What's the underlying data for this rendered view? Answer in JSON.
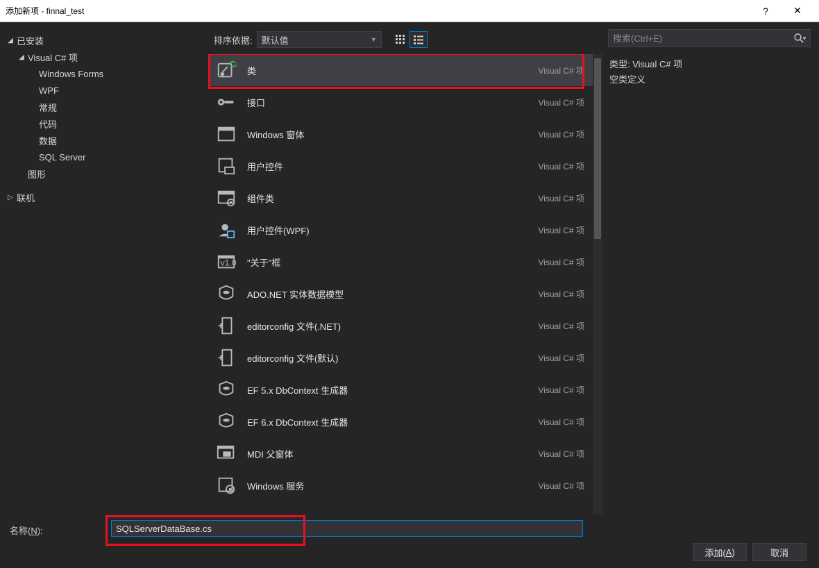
{
  "window": {
    "title": "添加新项 - finnal_test"
  },
  "sidebar": {
    "installed": "已安装",
    "vcs": "Visual C# 项",
    "children": [
      "Windows Forms",
      "WPF",
      "常规",
      "代码",
      "数据",
      "SQL Server"
    ],
    "graphics": "图形",
    "online": "联机"
  },
  "sort": {
    "label": "排序依据:",
    "value": "默认值"
  },
  "templates": [
    {
      "name": "类",
      "lang": "Visual C# 项"
    },
    {
      "name": "接口",
      "lang": "Visual C# 项"
    },
    {
      "name": "Windows 窗体",
      "lang": "Visual C# 项"
    },
    {
      "name": "用户控件",
      "lang": "Visual C# 项"
    },
    {
      "name": "组件类",
      "lang": "Visual C# 项"
    },
    {
      "name": "用户控件(WPF)",
      "lang": "Visual C# 项"
    },
    {
      "name": "\"关于\"框",
      "lang": "Visual C# 项"
    },
    {
      "name": "ADO.NET 实体数据模型",
      "lang": "Visual C# 项"
    },
    {
      "name": "editorconfig 文件(.NET)",
      "lang": "Visual C# 项"
    },
    {
      "name": "editorconfig 文件(默认)",
      "lang": "Visual C# 项"
    },
    {
      "name": "EF 5.x DbContext 生成器",
      "lang": "Visual C# 项"
    },
    {
      "name": "EF 6.x DbContext 生成器",
      "lang": "Visual C# 项"
    },
    {
      "name": "MDI 父窗体",
      "lang": "Visual C# 项"
    },
    {
      "name": "Windows 服务",
      "lang": "Visual C# 项"
    }
  ],
  "details": {
    "search_placeholder": "搜索(Ctrl+E)",
    "type_label": "类型: ",
    "type_value": "Visual C# 项",
    "desc": "空类定义"
  },
  "nameField": {
    "label_pre": "名称(",
    "label_key": "N",
    "label_post": "):",
    "value": "SQLServerDataBase.cs"
  },
  "buttons": {
    "add_pre": "添加(",
    "add_key": "A",
    "add_post": ")",
    "cancel": "取消"
  }
}
